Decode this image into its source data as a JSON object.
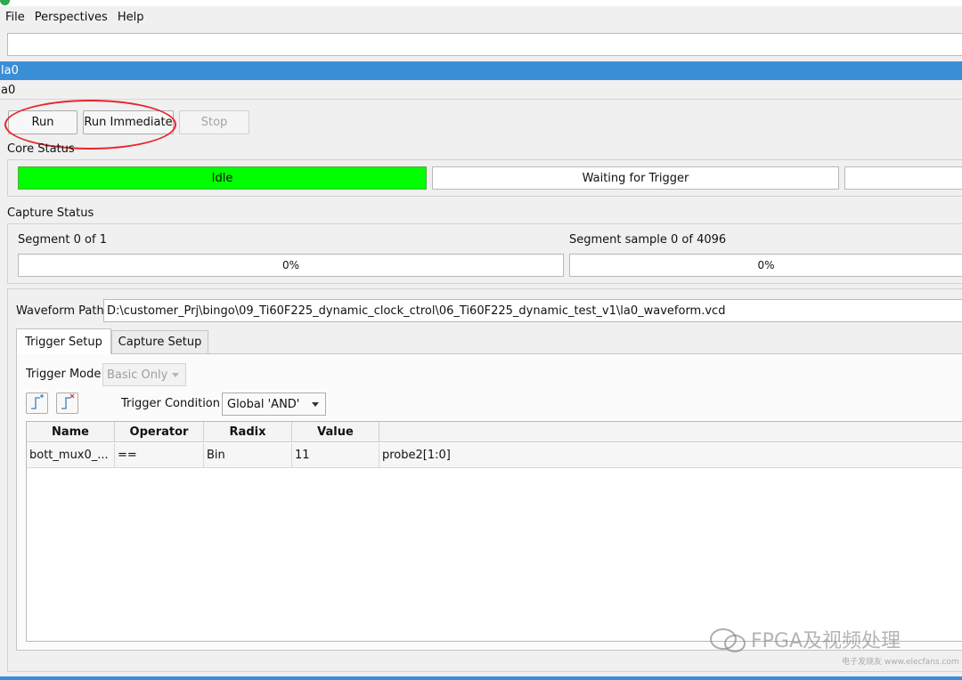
{
  "menu": [
    "File",
    "Perspectives",
    "Help"
  ],
  "tree": {
    "selected": "la0",
    "child": "a0"
  },
  "toolbar": {
    "run": "Run",
    "run_immediate": "Run Immediate",
    "stop": "Stop"
  },
  "core_status": {
    "label": "Core Status",
    "boxes": [
      "Idle",
      "Waiting for Trigger",
      ""
    ],
    "idle_color": "#00ff00"
  },
  "capture_status": {
    "label": "Capture Status",
    "segment_label": "Segment 0 of 1",
    "segment_progress": "0%",
    "sample_label": "Segment sample 0 of 4096",
    "sample_progress": "0%"
  },
  "waveform": {
    "label": "Waveform Path",
    "path": "D:\\customer_Prj\\bingo\\09_Ti60F225_dynamic_clock_ctrol\\06_Ti60F225_dynamic_test_v1\\la0_waveform.vcd"
  },
  "tabs": [
    "Trigger Setup",
    "Capture Setup"
  ],
  "trigger": {
    "mode_label": "Trigger Mode",
    "mode_value": "Basic Only",
    "condition_label": "Trigger Condition",
    "condition_value": "Global 'AND'"
  },
  "table": {
    "headers": [
      "Name",
      "Operator",
      "Radix",
      "Value",
      ""
    ],
    "rows": [
      [
        "bott_mux0_...",
        "==",
        "Bin",
        "11",
        "probe2[1:0]"
      ]
    ]
  },
  "watermark": {
    "text": "FPGA及视频处理",
    "small": "电子发烧友 www.elecfans.com"
  }
}
